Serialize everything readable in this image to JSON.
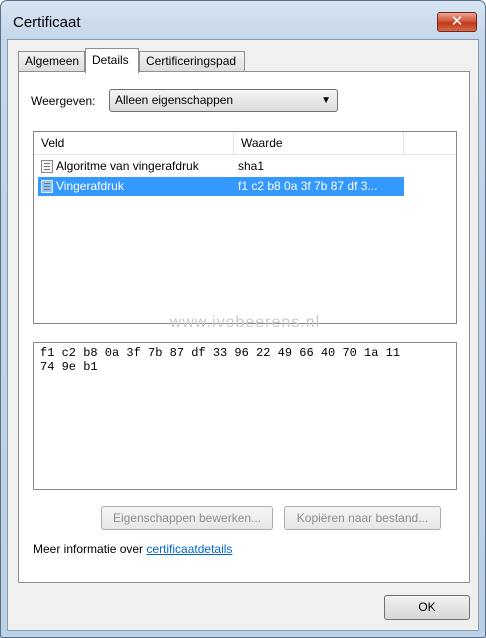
{
  "window": {
    "title": "Certificaat"
  },
  "tabs": [
    {
      "label": "Algemeen"
    },
    {
      "label": "Details"
    },
    {
      "label": "Certificeringspad"
    }
  ],
  "show": {
    "label": "Weergeven:",
    "selected": "Alleen eigenschappen"
  },
  "list": {
    "columns": [
      "Veld",
      "Waarde"
    ],
    "rows": [
      {
        "field": "Algoritme van vingerafdruk",
        "value": "sha1"
      },
      {
        "field": "Vingerafdruk",
        "value": "f1 c2 b8 0a 3f 7b 87 df 3..."
      }
    ],
    "selected_index": 1
  },
  "watermark": "www.ivobeerens.nl",
  "value_text": "f1 c2 b8 0a 3f 7b 87 df 33 96 22 49 66 40 70 1a 11\n74 9e b1",
  "buttons": {
    "edit_properties": "Eigenschappen bewerken...",
    "copy_to_file": "Kopiëren naar bestand...",
    "ok": "OK"
  },
  "more_info": {
    "text": "Meer informatie over",
    "link": "certificaatdetails"
  }
}
